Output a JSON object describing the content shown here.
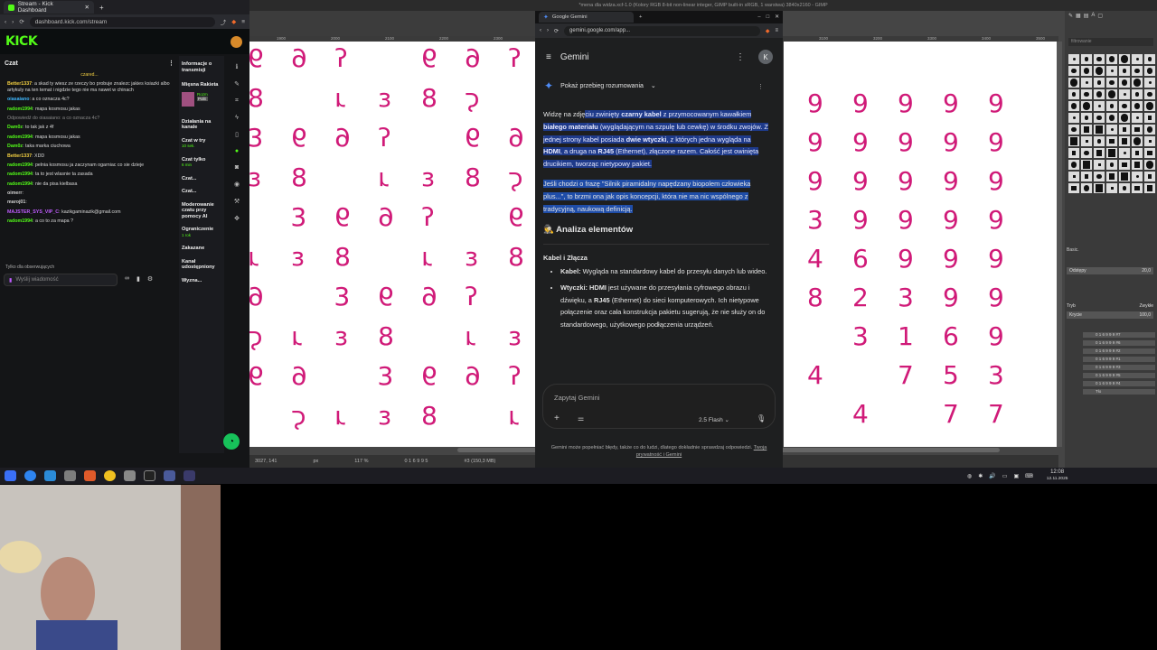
{
  "kick": {
    "tab_title": "Stream - Kick Dashboard",
    "url": "dashboard.kick.com/stream",
    "logo": "KICK",
    "chat_title": "Czat",
    "pinned": "czared...",
    "messages": [
      {
        "user": "Better1337",
        "text": "a skad ty wiesz ze rzeczy bo probuje znalezc jakies ksiazki albo artykuly na ten temat i nigdzie tego nie ma nawet w chinach",
        "color": "#f5d142"
      },
      {
        "user": "oiasaiano",
        "text": "a co oznacza 4c?",
        "color": "#3fb8ff"
      },
      {
        "user": "radom1994",
        "text": "mapa kosmosu jakas",
        "color": "#53fc18"
      },
      {
        "user": "",
        "text": "Odpowiedź do oiasaiano: a co oznacza 4c?",
        "color": "#888"
      },
      {
        "user": "Dam0z",
        "text": "to tak jak z 4f",
        "color": "#53fc18"
      },
      {
        "user": "radom1994",
        "text": "mapa kosmosu jakas",
        "color": "#53fc18"
      },
      {
        "user": "Dam0z",
        "text": "taka marka ciuchowa",
        "color": "#53fc18"
      },
      {
        "user": "Better1337",
        "text": "XDD",
        "color": "#f5d142"
      },
      {
        "user": "radom1994",
        "text": "pelnia kosmosu ja zaczynam ogarniac co sie dzieje",
        "color": "#53fc18"
      },
      {
        "user": "radom1994",
        "text": "ta to jest wlasnie ta zasada",
        "color": "#53fc18"
      },
      {
        "user": "radom1994",
        "text": "nie da pisa kielbasa",
        "color": "#53fc18"
      },
      {
        "user": "oimerr",
        "text": "",
        "color": "#cfcfcf"
      },
      {
        "user": "maroj01",
        "text": "",
        "color": "#cfcfcf"
      },
      {
        "user": "MAJSTER_SYS_VIP_C",
        "text": "kazikgaminazik@gmail.com",
        "color": "#c05cff"
      },
      {
        "user": "radom1994",
        "text": "a co to za mapa ?",
        "color": "#53fc18"
      }
    ],
    "followers_only": "Tylko dla obserwujących",
    "chat_placeholder": "Wyślij wiadomość",
    "side": {
      "info_title": "Informacje o transmisji",
      "stream_name": "Mięsna Rakieta",
      "actions_title": "Działania na kanale",
      "items": [
        {
          "label": "Czat w try",
          "sub": "10 sek."
        },
        {
          "label": "Czat tylko",
          "sub": "6 min"
        },
        {
          "label": "Czat...",
          "sub": ""
        },
        {
          "label": "Czat...",
          "sub": ""
        },
        {
          "label": "Moderowanie czatu przy pomocy AI",
          "sub": ""
        },
        {
          "label": "Ograniczenie",
          "sub": "1 rok"
        },
        {
          "label": "Zakazane",
          "sub": ""
        },
        {
          "label": "Kanał udostępniony",
          "sub": ""
        },
        {
          "label": "Wyzna...",
          "sub": ""
        }
      ],
      "badge1": "Rozm",
      "badge2": "Polit"
    }
  },
  "gimp": {
    "title": "*mena dla widza.xcf-1.0 (Kolory RGB 8-bit non-linear integer, GIMP built-in sRGB, 1 warstwa) 3840x2160 - GIMP",
    "ruler_labels": [
      "1900",
      "2000",
      "2100",
      "2200",
      "2300",
      "3100",
      "3200",
      "3300",
      "3400",
      "3500"
    ],
    "status_coords": "3027, 141",
    "status_unit": "px",
    "status_zoom": "117 %",
    "status_info": "#3 (150,3 MB)",
    "status_layer": "0 1 6 9 9 5",
    "panel_mode_label": "Tryb",
    "panel_mode_value": "Zwykłe",
    "panel_opacity_label": "Krycie",
    "panel_opacity_value": "100,0",
    "panel_basic": "Basic.",
    "panel_spacing_label": "Odstępy",
    "panel_spacing_value": "20,0",
    "filter_placeholder": "filtrowanie",
    "layers": [
      "0 1 6 9 9 9 #7",
      "0 1 6 9 9 9 #6",
      "0 1 6 9 9 9 #2",
      "0 1 6 9 9 9 #1",
      "0 1 6 9 9 9 #3",
      "0 1 6 9 9 9 #5",
      "0 1 6 9 9 9 #4",
      "Tło"
    ],
    "right_digits": [
      [
        "9",
        "9",
        "9",
        "9",
        "9"
      ],
      [
        "9",
        "9",
        "9",
        "9",
        "9"
      ],
      [
        "9",
        "9",
        "9",
        "9",
        "9"
      ],
      [
        "3",
        "9",
        "9",
        "9",
        "9"
      ],
      [
        "4",
        "6",
        "9",
        "9",
        "9"
      ],
      [
        "8",
        "2",
        "3",
        "9",
        "9"
      ],
      [
        "",
        "3",
        "1",
        "6",
        "9"
      ],
      [
        "4",
        "",
        "7",
        "5",
        "3"
      ],
      [
        "",
        "4",
        "",
        "7",
        "7"
      ]
    ]
  },
  "gemini": {
    "tab_title": "Google Gemini",
    "url": "gemini.google.com/app...",
    "title": "Gemini",
    "avatar": "K",
    "reasoning": "Pokaż przebieg rozumowania",
    "p1_a": "Widzę na zdję",
    "p1_b": "ciu zwinięty ",
    "p1_b1": "czarny kabel",
    "p1_c": " z przymocowanym kawałkiem ",
    "p1_d": "białego materiału",
    "p1_e": " (wyglądającym na szpulę lub cewkę) w środku zwojów. Z jednej strony kabel posiada ",
    "p1_f": "dwie wtyczki",
    "p1_g": ", z których jedna wygląda na ",
    "p1_h": "HDMI",
    "p1_i": ", a druga na ",
    "p1_j": "RJ45",
    "p1_k": " (Ethernet), złączone razem. Całość jest owinięta drucikiem, tworząc nietypowy pakiet.",
    "p2": "Jeśli chodzi o frazę \"Silnik piramidalny napędzany biopolem człowieka plus...\", to brzmi ona jak opis koncepcji, która nie ma nic wspólnego z tradycyjną, naukową definicją.",
    "h_analysis": "🕵️ Analiza elementów",
    "h_cable": "Kabel i Złącza",
    "b1_label": "Kabel:",
    "b1_text": " Wygląda na standardowy kabel do przesyłu danych lub wideo.",
    "b2_label": "Wtyczki:",
    "b2_hdmi": " HDMI",
    "b2_text1": " jest używane do przesyłania cyfrowego obrazu i dźwięku, a ",
    "b2_rj": "RJ45",
    "b2_text2": " (Ethernet) do sieci komputerowych. Ich nietypowe połączenie oraz cała konstrukcja pakietu sugerują, że nie służy on do standardowego, użytkowego podłączenia urządzeń.",
    "input_placeholder": "Zapytaj Gemini",
    "model": "2.5 Flash",
    "footer": "Gemini może popełniać błędy, także co do ludzi, dlatego dokładnie sprawdzaj odpowiedzi.",
    "footer_link": "Twoja prywatność i Gemini"
  },
  "taskbar": {
    "time": "12:08",
    "date": "12.11.2025"
  }
}
